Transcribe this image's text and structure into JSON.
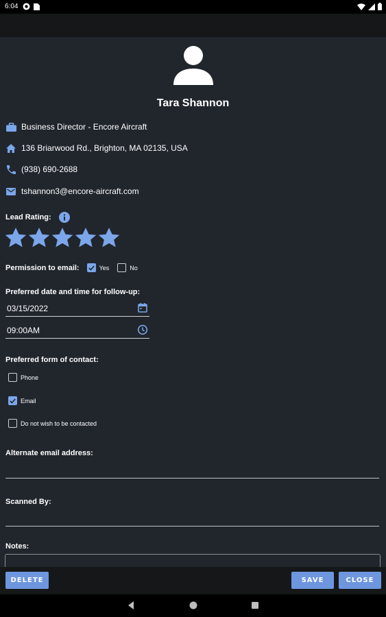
{
  "status": {
    "time": "6:04"
  },
  "contact": {
    "name": "Tara Shannon",
    "title": "Business Director - Encore Aircraft",
    "address": "136 Briarwood Rd., Brighton, MA 02135, USA",
    "phone": "(938) 690-2688",
    "email": "tshannon3@encore-aircraft.com"
  },
  "lead_rating": {
    "label": "Lead Rating:",
    "stars": 5,
    "max": 5
  },
  "permission": {
    "label": "Permission to email:",
    "yes_label": "Yes",
    "no_label": "No",
    "yes_checked": true,
    "no_checked": false
  },
  "followup": {
    "label": "Preferred date and time for follow-up:",
    "date": "03/15/2022",
    "time": "09:00AM"
  },
  "contact_form": {
    "label": "Preferred form of contact:",
    "options": [
      {
        "label": "Phone",
        "checked": false
      },
      {
        "label": "Email",
        "checked": true
      },
      {
        "label": "Do not wish to be contacted",
        "checked": false
      }
    ]
  },
  "alt_email": {
    "label": "Alternate email address:",
    "value": ""
  },
  "scanned_by": {
    "label": "Scanned By:",
    "value": ""
  },
  "notes": {
    "label": "Notes:",
    "value": ""
  },
  "buttons": {
    "delete": "DELETE",
    "save": "SAVE",
    "close": "CLOSE"
  },
  "colors": {
    "accent": "#6e96de",
    "background": "#21262d",
    "bar": "#161718"
  }
}
